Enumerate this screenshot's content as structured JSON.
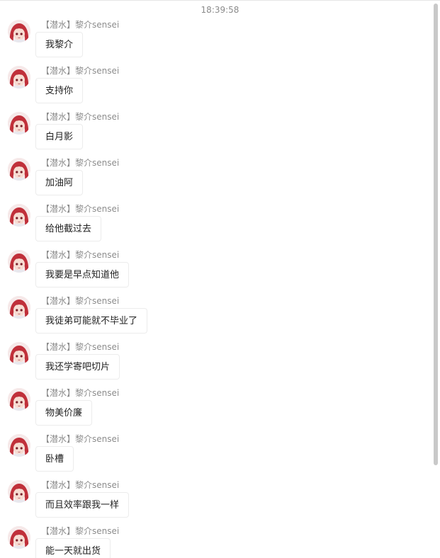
{
  "timestamp": "18:39:58",
  "messages": [
    {
      "sender": "【潜水】黎介sensei",
      "text": "我黎介"
    },
    {
      "sender": "【潜水】黎介sensei",
      "text": "支持你"
    },
    {
      "sender": "【潜水】黎介sensei",
      "text": "白月影"
    },
    {
      "sender": "【潜水】黎介sensei",
      "text": "加油阿"
    },
    {
      "sender": "【潜水】黎介sensei",
      "text": "给他截过去"
    },
    {
      "sender": "【潜水】黎介sensei",
      "text": "我要是早点知道他"
    },
    {
      "sender": "【潜水】黎介sensei",
      "text": "我徒弟可能就不毕业了"
    },
    {
      "sender": "【潜水】黎介sensei",
      "text": "我还学寄吧切片"
    },
    {
      "sender": "【潜水】黎介sensei",
      "text": "物美价廉"
    },
    {
      "sender": "【潜水】黎介sensei",
      "text": "卧槽"
    },
    {
      "sender": "【潜水】黎介sensei",
      "text": "而且效率跟我一样"
    },
    {
      "sender": "【潜水】黎介sensei",
      "text": "能一天就出货"
    }
  ],
  "avatar_icon": "anime-girl-red-hair-avatar",
  "colors": {
    "hair": "#c0303a",
    "sender_text": "#8c8c8c",
    "bubble_border": "#ececec",
    "scrollbar": "#c9c9c9"
  }
}
